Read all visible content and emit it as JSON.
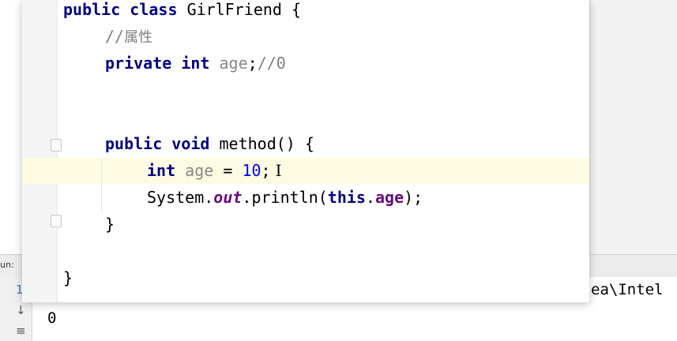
{
  "run_panel": {
    "label": "un:",
    "output": "0",
    "command_fragment": "ea\\Intel",
    "icons": {
      "rerun": "1",
      "down": "↓",
      "wrap": "≡"
    }
  },
  "code": {
    "line1": {
      "kw1": "public",
      "kw2": "class",
      "name": "GirlFriend",
      "brace": "{"
    },
    "line2": {
      "comment_slashes": "//",
      "comment_text": "属性"
    },
    "line3": {
      "kw1": "private",
      "kw2": "int",
      "field": "age",
      "semi": ";",
      "comment": "//0"
    },
    "line4": {
      "kw1": "public",
      "kw2": "void",
      "name": "method",
      "rest": "() {"
    },
    "line5": {
      "kw": "int",
      "var": "age",
      "op": "=",
      "num": "10",
      "semi": ";",
      "caret": "I"
    },
    "line6": {
      "sys": "System.",
      "out": "out",
      "call": ".println(",
      "this": "this",
      "dot": ".",
      "field": "age",
      "end": ");"
    },
    "line7": {
      "brace": "}"
    },
    "line8": {
      "brace": "}"
    }
  }
}
